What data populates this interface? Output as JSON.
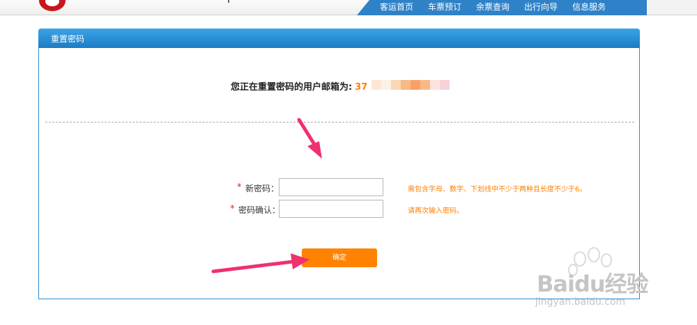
{
  "header": {
    "nav_items": [
      "客运首页",
      "车票预订",
      "余票查询",
      "出行向导",
      "信息服务"
    ]
  },
  "panel": {
    "title": "重置密码",
    "email_label": "您正在重置密码的用户邮箱为:",
    "email_value": "37"
  },
  "form": {
    "new_password": {
      "label": "新密码：",
      "required_mark": "*",
      "value": "",
      "hint": "需包含字母、数字、下划线中不少于两种且长度不少于6。"
    },
    "confirm_password": {
      "label": "密码确认：",
      "required_mark": "*",
      "value": "",
      "hint": "请再次输入密码。"
    },
    "submit_label": "确定"
  },
  "watermark": {
    "brand": "Baidu经验",
    "url": "jingyan.baidu.com"
  },
  "colors": {
    "nav_bar": "#2f82c8",
    "panel_header": "#1d7cc4",
    "accent_orange": "#ff8200",
    "required_red": "#e02020",
    "annotation_arrow": "#f0306f"
  }
}
